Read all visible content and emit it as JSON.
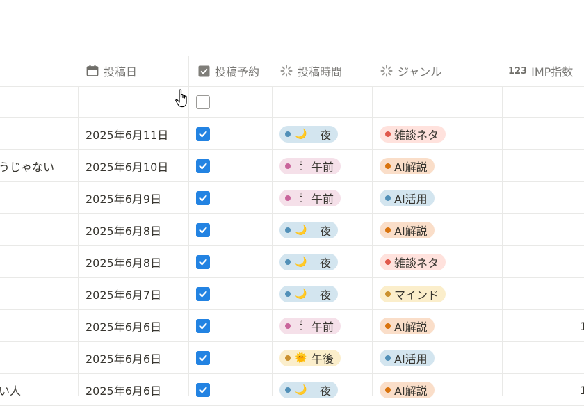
{
  "headers": {
    "date": "投稿日",
    "scheduled": "投稿予約",
    "time": "投稿時間",
    "genre": "ジャンル",
    "imp_prefix": "123",
    "imp": "IMP指数"
  },
  "colors": {
    "blue_bg": "#d3e5ef",
    "blue_dot": "#5190b8",
    "pink_bg": "#f5e0e9",
    "pink_dot": "#c9649b",
    "yellow_bg": "#fbeecb",
    "yellow_dot": "#cb912f",
    "red_bg": "#ffe2dd",
    "red_dot": "#e0584b",
    "orange_bg": "#fadec9",
    "orange_dot": "#d9730d",
    "checkbox": "#2383e2"
  },
  "rows": [
    {
      "title": "",
      "date": "",
      "checked": false,
      "time": null,
      "genre": null,
      "imp": ""
    },
    {
      "title": "",
      "date": "2025年6月11日",
      "checked": true,
      "time": {
        "label": "夜",
        "emoji": "🌙",
        "color": "blue"
      },
      "genre": {
        "label": "雑談ネタ",
        "color": "red"
      },
      "imp": ""
    },
    {
      "title": "うじゃない",
      "date": "2025年6月10日",
      "checked": true,
      "time": {
        "label": "午前",
        "emoji": "🕯",
        "color": "pink"
      },
      "genre": {
        "label": "AI解説",
        "color": "orange"
      },
      "imp": ""
    },
    {
      "title": "",
      "date": "2025年6月9日",
      "checked": true,
      "time": {
        "label": "午前",
        "emoji": "🕯",
        "color": "pink"
      },
      "genre": {
        "label": "AI活用",
        "color": "blue"
      },
      "imp": ""
    },
    {
      "title": "",
      "date": "2025年6月8日",
      "checked": true,
      "time": {
        "label": "夜",
        "emoji": "🌙",
        "color": "blue"
      },
      "genre": {
        "label": "AI解説",
        "color": "orange"
      },
      "imp": ""
    },
    {
      "title": "",
      "date": "2025年6月8日",
      "checked": true,
      "time": {
        "label": "夜",
        "emoji": "🌙",
        "color": "blue"
      },
      "genre": {
        "label": "雑談ネタ",
        "color": "red"
      },
      "imp": ""
    },
    {
      "title": "",
      "date": "2025年6月7日",
      "checked": true,
      "time": {
        "label": "夜",
        "emoji": "🌙",
        "color": "blue"
      },
      "genre": {
        "label": "マインド",
        "color": "yellow"
      },
      "imp": ""
    },
    {
      "title": "",
      "date": "2025年6月6日",
      "checked": true,
      "time": {
        "label": "午前",
        "emoji": "🕯",
        "color": "pink"
      },
      "genre": {
        "label": "AI解説",
        "color": "orange"
      },
      "imp": "1"
    },
    {
      "title": "",
      "date": "2025年6月6日",
      "checked": true,
      "time": {
        "label": "午後",
        "emoji": "🌞",
        "color": "yellow"
      },
      "genre": {
        "label": "AI活用",
        "color": "blue"
      },
      "imp": ""
    },
    {
      "title": "い人",
      "date": "2025年6月6日",
      "checked": true,
      "time": {
        "label": "夜",
        "emoji": "🌙",
        "color": "blue"
      },
      "genre": {
        "label": "AI解説",
        "color": "orange"
      },
      "imp": "1"
    }
  ]
}
